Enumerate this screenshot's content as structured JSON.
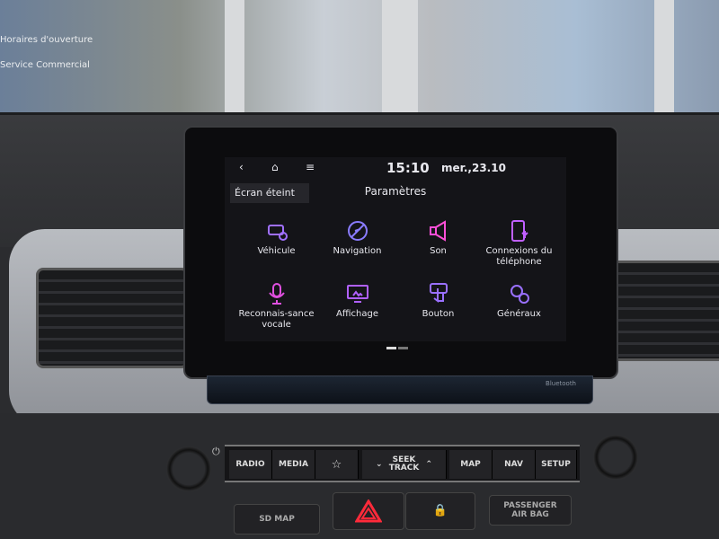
{
  "background": {
    "window_sign_lines": [
      "Horaires d'ouverture",
      "Service Commercial"
    ]
  },
  "statusbar": {
    "back_icon": "‹",
    "home_icon": "⌂",
    "menu_icon": "≡",
    "time": "15:10",
    "date": "mer.,23.10"
  },
  "header": {
    "screen_off_label": "Écran éteint",
    "title": "Paramètres"
  },
  "settings": [
    {
      "label": "Véhicule",
      "icon": "car-gear-icon",
      "color": "#a070ff"
    },
    {
      "label": "Navigation",
      "icon": "compass-icon",
      "color": "#8a7cff"
    },
    {
      "label": "Son",
      "icon": "speaker-icon",
      "color": "#ff4fd8"
    },
    {
      "label": "Connexions du téléphone",
      "icon": "phone-connection-icon",
      "color": "#c060ff"
    },
    {
      "label": "Reconnais-sance vocale",
      "icon": "microphone-icon",
      "color": "#e050e0"
    },
    {
      "label": "Affichage",
      "icon": "display-icon",
      "color": "#b060ff"
    },
    {
      "label": "Bouton",
      "icon": "button-press-icon",
      "color": "#9a70ff"
    },
    {
      "label": "Généraux",
      "icon": "gears-icon",
      "color": "#9a70ff"
    }
  ],
  "pager": {
    "current_page": 1,
    "total_pages": 2
  },
  "bezel": {
    "bluetooth_label": "Bluetooth"
  },
  "panel": {
    "radio": "RADIO",
    "media": "MEDIA",
    "favorite_icon": "☆",
    "seek_down": "⌄",
    "seek": "SEEK TRACK",
    "seek_up": "⌃",
    "map": "MAP",
    "nav": "NAV",
    "setup": "SETUP",
    "power_icon": "⏻"
  },
  "lower": {
    "sd_map": "SD MAP",
    "hazard_icon": "hazard-triangle",
    "lock_icon": "🔒",
    "airbag": "PASSENGER AIR BAG"
  }
}
